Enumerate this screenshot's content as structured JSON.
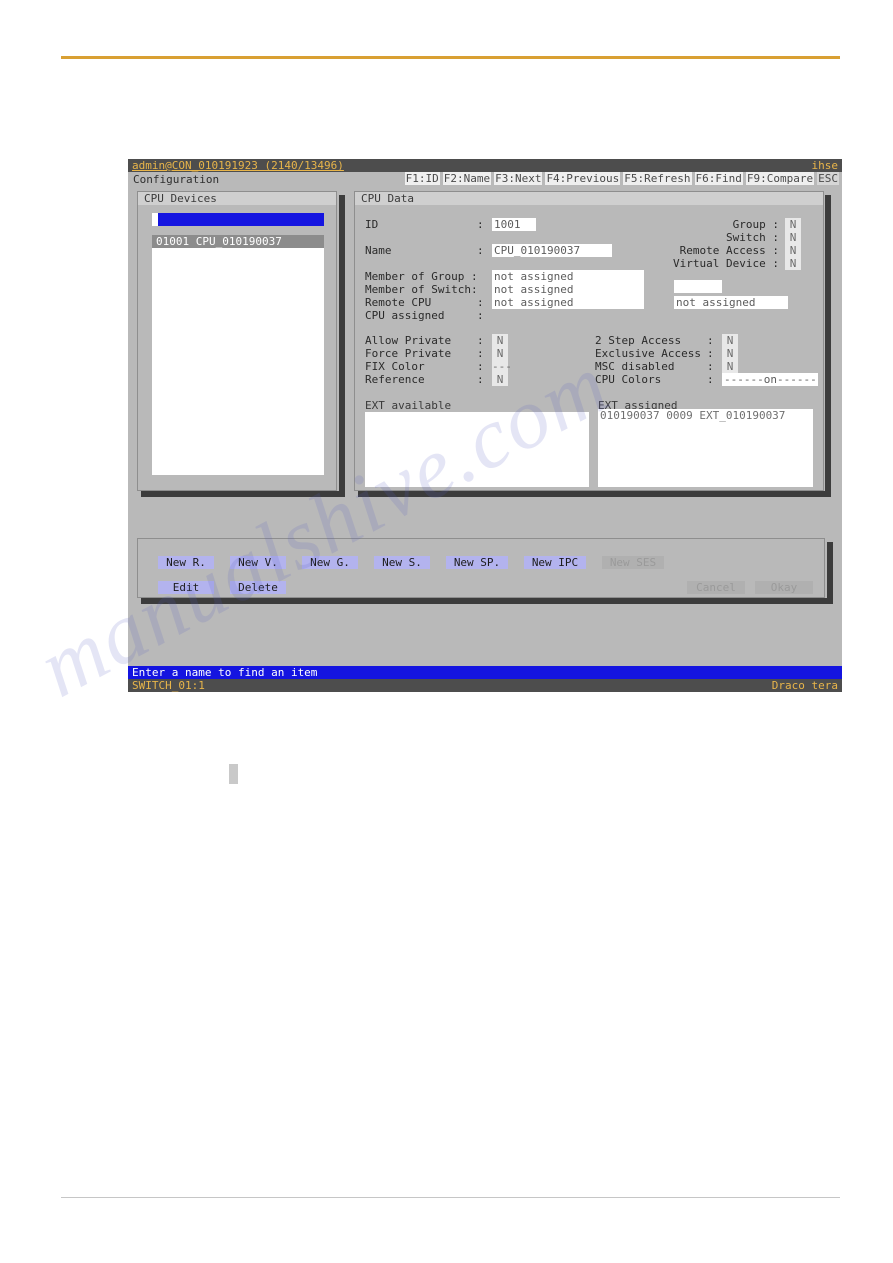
{
  "terminal": {
    "titlebar": {
      "session": "admin@CON_010191923 (2140/13496)",
      "brand": "ihse"
    },
    "menubar": {
      "title": "Configuration",
      "function_keys": [
        "F1:ID",
        "F2:Name",
        "F3:Next",
        "F4:Previous",
        "F5:Refresh",
        "F6:Find",
        "F9:Compare",
        "ESC"
      ]
    },
    "left_panel": {
      "header": "CPU Devices",
      "search": {
        "value": "",
        "placeholder": ""
      },
      "devices": [
        {
          "label": "01001 CPU_010190037",
          "selected": true
        }
      ]
    },
    "right_panel": {
      "header": "CPU Data",
      "fields": {
        "id_label": "ID",
        "id_sep": ":",
        "id_value": "1001",
        "name_label": "Name",
        "name_sep": ":",
        "name_value": "CPU_010190037",
        "member_of_group_label": "Member of Group :",
        "member_of_group_value": "not assigned",
        "member_of_switch_label": "Member of Switch:",
        "member_of_switch_value": "not assigned",
        "remote_cpu_label": "Remote CPU",
        "remote_cpu_sep": ":",
        "remote_cpu_value": "not assigned",
        "remote_cpu_extra_value": "not assigned",
        "remote_cpu_extra_blank": "",
        "cpu_assigned_label": "CPU assigned",
        "cpu_assigned_sep": ":"
      },
      "flags_right_top": [
        {
          "label": "Group :",
          "value": "N"
        },
        {
          "label": "Switch :",
          "value": "N"
        },
        {
          "label": "Remote Access :",
          "value": "N"
        },
        {
          "label": "Virtual Device :",
          "value": "N"
        }
      ],
      "options_left": [
        {
          "label": "Allow Private",
          "sep": ":",
          "value": "N"
        },
        {
          "label": "Force Private",
          "sep": ":",
          "value": "N"
        },
        {
          "label": "FIX Color",
          "sep": ":",
          "value": "---"
        },
        {
          "label": "Reference",
          "sep": ":",
          "value": "N"
        }
      ],
      "options_right": [
        {
          "label": "2 Step Access",
          "sep": ":",
          "value": "N"
        },
        {
          "label": "Exclusive Access",
          "sep": ":",
          "value": "N"
        },
        {
          "label": "MSC disabled",
          "sep": ":",
          "value": "N"
        },
        {
          "label": "CPU Colors",
          "sep": ":",
          "value": "------on------"
        }
      ],
      "ext_available": {
        "label": "EXT available",
        "rows": []
      },
      "ext_assigned": {
        "label": "EXT assigned",
        "rows": [
          "010190037 0009 EXT_010190037"
        ]
      }
    },
    "buttons": {
      "row1": [
        {
          "label": "New R.",
          "disabled": false
        },
        {
          "label": "New V.",
          "disabled": false
        },
        {
          "label": "New G.",
          "disabled": false
        },
        {
          "label": "New S.",
          "disabled": false
        },
        {
          "label": "New SP.",
          "disabled": false
        },
        {
          "label": "New IPC",
          "disabled": false
        },
        {
          "label": "New SES",
          "disabled": true
        }
      ],
      "row2": [
        {
          "label": "Edit",
          "disabled": false
        },
        {
          "label": "Delete",
          "disabled": false
        }
      ],
      "row2_right": [
        {
          "label": "Cancel",
          "disabled": true
        },
        {
          "label": "Okay",
          "disabled": true
        }
      ]
    },
    "hintbar": "Enter a name to find an item",
    "statusbar": {
      "left": "SWITCH_01:1",
      "right": "Draco tera"
    }
  },
  "colors": {
    "rule_top": "#d9a033",
    "rule_bottom": "#c6c6c6",
    "terminal_bg": "#b9b9b9",
    "titlebar_bg": "#4d4d4d",
    "titlebar_fg": "#e8b54a",
    "highlight_blue": "#1414e0",
    "button_blue": "#b3b3ee",
    "panel_header": "#cfcfcf"
  },
  "watermark": {
    "line1": "manualshive.com",
    "line2": ""
  }
}
